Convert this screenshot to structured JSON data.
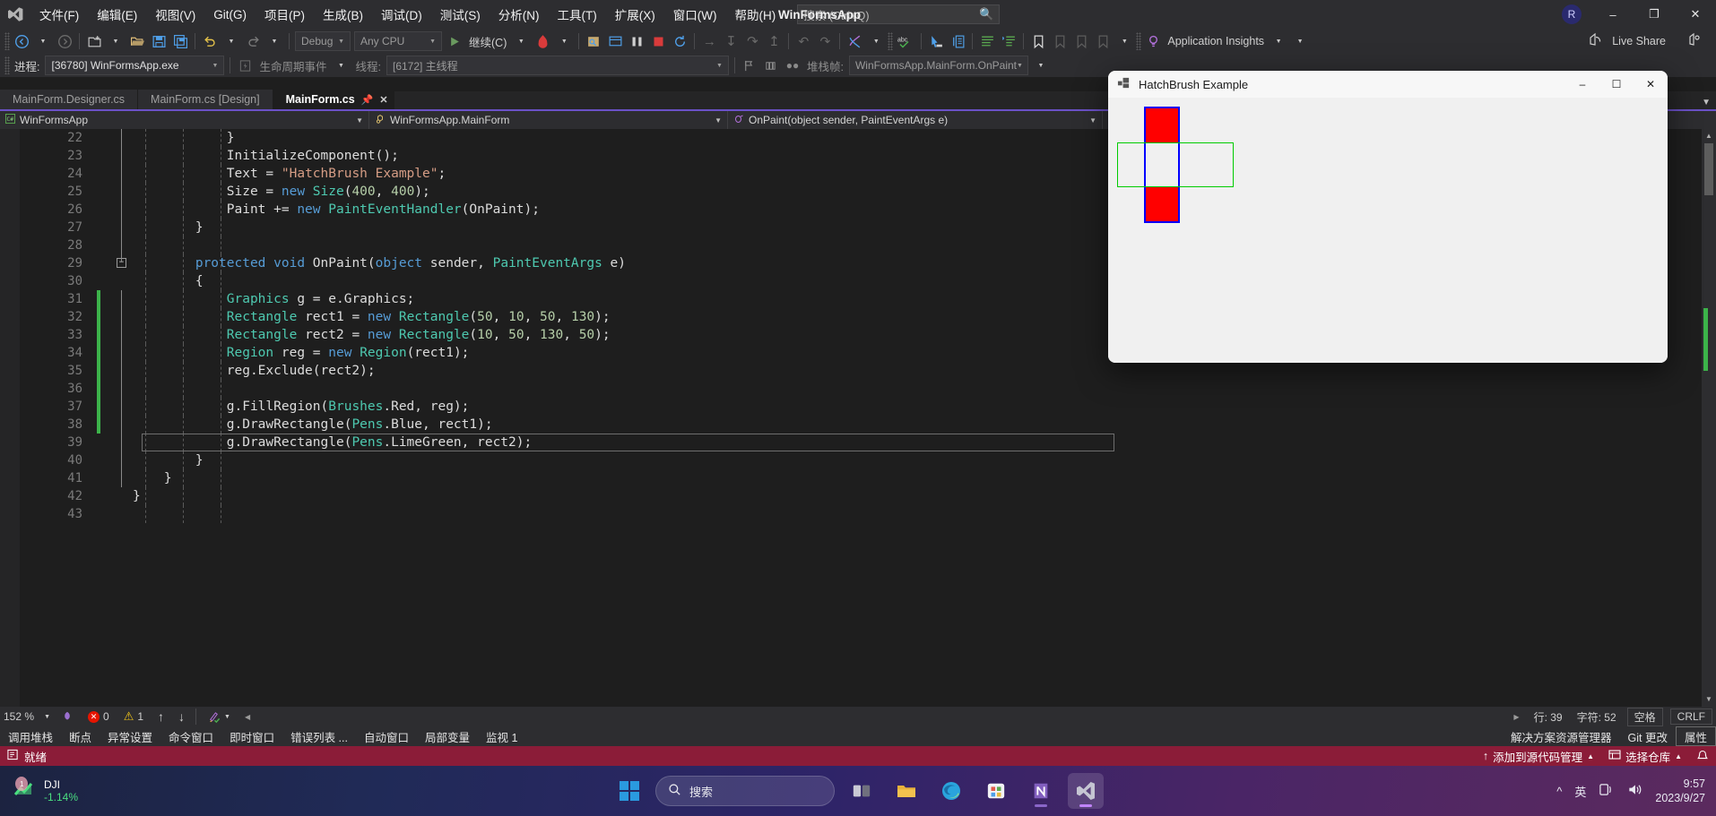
{
  "window": {
    "app_title": "WinFormsApp",
    "account_initial": "R",
    "minimize": "–",
    "restore": "❐",
    "close": "✕"
  },
  "menu": {
    "items": [
      {
        "label": "文件(F)",
        "name": "menu-file"
      },
      {
        "label": "编辑(E)",
        "name": "menu-edit"
      },
      {
        "label": "视图(V)",
        "name": "menu-view"
      },
      {
        "label": "Git(G)",
        "name": "menu-git"
      },
      {
        "label": "项目(P)",
        "name": "menu-project"
      },
      {
        "label": "生成(B)",
        "name": "menu-build"
      },
      {
        "label": "调试(D)",
        "name": "menu-debug"
      },
      {
        "label": "测试(S)",
        "name": "menu-test"
      },
      {
        "label": "分析(N)",
        "name": "menu-analyze"
      },
      {
        "label": "工具(T)",
        "name": "menu-tools"
      },
      {
        "label": "扩展(X)",
        "name": "menu-extensions"
      },
      {
        "label": "窗口(W)",
        "name": "menu-window"
      },
      {
        "label": "帮助(H)",
        "name": "menu-help"
      }
    ],
    "search_placeholder": "搜索 (Ctrl+Q)"
  },
  "toolbar": {
    "config": "Debug",
    "platform": "Any CPU",
    "continue_label": "继续(C)",
    "app_insights": "Application Insights",
    "live_share": "Live Share"
  },
  "debugbar": {
    "process_label": "进程:",
    "process_value": "[36780] WinFormsApp.exe",
    "lifecycle_label": "生命周期事件",
    "thread_label": "线程:",
    "thread_value": "[6172] 主线程",
    "stackframe_label": "堆栈帧:",
    "stackframe_value": "WinFormsApp.MainForm.OnPaint"
  },
  "tabs": [
    {
      "label": "MainForm.Designer.cs",
      "active": false
    },
    {
      "label": "MainForm.cs [Design]",
      "active": false
    },
    {
      "label": "MainForm.cs",
      "active": true
    }
  ],
  "navbar": {
    "project": "WinFormsApp",
    "type": "WinFormsApp.MainForm",
    "member": "OnPaint(object sender, PaintEventArgs e)"
  },
  "code": {
    "lines": [
      {
        "num": "22",
        "changed": false,
        "tokens": [
          {
            "t": "            }",
            "c": "k-def"
          }
        ]
      },
      {
        "num": "23",
        "changed": false,
        "tokens": [
          {
            "t": "            ",
            "c": "k-def"
          },
          {
            "t": "InitializeComponent",
            "c": "k-def"
          },
          {
            "t": "();",
            "c": "k-def"
          }
        ]
      },
      {
        "num": "24",
        "changed": false,
        "tokens": [
          {
            "t": "            Text = ",
            "c": "k-def"
          },
          {
            "t": "\"HatchBrush Example\"",
            "c": "k-str"
          },
          {
            "t": ";",
            "c": "k-def"
          }
        ]
      },
      {
        "num": "25",
        "changed": false,
        "tokens": [
          {
            "t": "            Size = ",
            "c": "k-def"
          },
          {
            "t": "new ",
            "c": "k-blue"
          },
          {
            "t": "Size",
            "c": "k-cyan"
          },
          {
            "t": "(",
            "c": "k-def"
          },
          {
            "t": "400",
            "c": "k-num"
          },
          {
            "t": ", ",
            "c": "k-def"
          },
          {
            "t": "400",
            "c": "k-num"
          },
          {
            "t": ");",
            "c": "k-def"
          }
        ]
      },
      {
        "num": "26",
        "changed": false,
        "tokens": [
          {
            "t": "            Paint += ",
            "c": "k-def"
          },
          {
            "t": "new ",
            "c": "k-blue"
          },
          {
            "t": "PaintEventHandler",
            "c": "k-cyan"
          },
          {
            "t": "(OnPaint);",
            "c": "k-def"
          }
        ]
      },
      {
        "num": "27",
        "changed": false,
        "tokens": [
          {
            "t": "        }",
            "c": "k-def"
          }
        ]
      },
      {
        "num": "28",
        "changed": false,
        "tokens": []
      },
      {
        "num": "29",
        "changed": false,
        "tokens": [
          {
            "t": "        ",
            "c": "k-def"
          },
          {
            "t": "protected void ",
            "c": "k-blue"
          },
          {
            "t": "OnPaint",
            "c": "k-def"
          },
          {
            "t": "(",
            "c": "k-def"
          },
          {
            "t": "object",
            "c": "k-blue"
          },
          {
            "t": " sender, ",
            "c": "k-def"
          },
          {
            "t": "PaintEventArgs",
            "c": "k-cyan"
          },
          {
            "t": " e)",
            "c": "k-def"
          }
        ]
      },
      {
        "num": "30",
        "changed": false,
        "tokens": [
          {
            "t": "        {",
            "c": "k-def"
          }
        ]
      },
      {
        "num": "31",
        "changed": true,
        "tokens": [
          {
            "t": "            ",
            "c": "k-def"
          },
          {
            "t": "Graphics",
            "c": "k-cyan"
          },
          {
            "t": " g = e.Graphics;",
            "c": "k-def"
          }
        ]
      },
      {
        "num": "32",
        "changed": true,
        "tokens": [
          {
            "t": "            ",
            "c": "k-def"
          },
          {
            "t": "Rectangle",
            "c": "k-cyan"
          },
          {
            "t": " rect1 = ",
            "c": "k-def"
          },
          {
            "t": "new ",
            "c": "k-blue"
          },
          {
            "t": "Rectangle",
            "c": "k-cyan"
          },
          {
            "t": "(",
            "c": "k-def"
          },
          {
            "t": "50",
            "c": "k-num"
          },
          {
            "t": ", ",
            "c": "k-def"
          },
          {
            "t": "10",
            "c": "k-num"
          },
          {
            "t": ", ",
            "c": "k-def"
          },
          {
            "t": "50",
            "c": "k-num"
          },
          {
            "t": ", ",
            "c": "k-def"
          },
          {
            "t": "130",
            "c": "k-num"
          },
          {
            "t": ");",
            "c": "k-def"
          }
        ]
      },
      {
        "num": "33",
        "changed": true,
        "tokens": [
          {
            "t": "            ",
            "c": "k-def"
          },
          {
            "t": "Rectangle",
            "c": "k-cyan"
          },
          {
            "t": " rect2 = ",
            "c": "k-def"
          },
          {
            "t": "new ",
            "c": "k-blue"
          },
          {
            "t": "Rectangle",
            "c": "k-cyan"
          },
          {
            "t": "(",
            "c": "k-def"
          },
          {
            "t": "10",
            "c": "k-num"
          },
          {
            "t": ", ",
            "c": "k-def"
          },
          {
            "t": "50",
            "c": "k-num"
          },
          {
            "t": ", ",
            "c": "k-def"
          },
          {
            "t": "130",
            "c": "k-num"
          },
          {
            "t": ", ",
            "c": "k-def"
          },
          {
            "t": "50",
            "c": "k-num"
          },
          {
            "t": ");",
            "c": "k-def"
          }
        ]
      },
      {
        "num": "34",
        "changed": true,
        "tokens": [
          {
            "t": "            ",
            "c": "k-def"
          },
          {
            "t": "Region",
            "c": "k-cyan"
          },
          {
            "t": " reg = ",
            "c": "k-def"
          },
          {
            "t": "new ",
            "c": "k-blue"
          },
          {
            "t": "Region",
            "c": "k-cyan"
          },
          {
            "t": "(rect1);",
            "c": "k-def"
          }
        ]
      },
      {
        "num": "35",
        "changed": true,
        "tokens": [
          {
            "t": "            reg.Exclude(rect2);",
            "c": "k-def"
          }
        ]
      },
      {
        "num": "36",
        "changed": true,
        "tokens": []
      },
      {
        "num": "37",
        "changed": true,
        "tokens": [
          {
            "t": "            g.FillRegion(",
            "c": "k-def"
          },
          {
            "t": "Brushes",
            "c": "k-cyan"
          },
          {
            "t": ".Red, reg);",
            "c": "k-def"
          }
        ]
      },
      {
        "num": "38",
        "changed": true,
        "tokens": [
          {
            "t": "            g.DrawRectangle(",
            "c": "k-def"
          },
          {
            "t": "Pens",
            "c": "k-cyan"
          },
          {
            "t": ".Blue, rect1);",
            "c": "k-def"
          }
        ]
      },
      {
        "num": "39",
        "changed": false,
        "current": true,
        "tokens": [
          {
            "t": "            g.DrawRectangle(",
            "c": "k-def"
          },
          {
            "t": "Pens",
            "c": "k-cyan"
          },
          {
            "t": ".LimeGreen, rect2);",
            "c": "k-def"
          }
        ]
      },
      {
        "num": "40",
        "changed": false,
        "tokens": [
          {
            "t": "        }",
            "c": "k-def"
          }
        ]
      },
      {
        "num": "41",
        "changed": false,
        "tokens": [
          {
            "t": "    }",
            "c": "k-def"
          }
        ]
      },
      {
        "num": "42",
        "changed": false,
        "tokens": [
          {
            "t": "}",
            "c": "k-def"
          }
        ]
      },
      {
        "num": "43",
        "changed": false,
        "tokens": []
      }
    ]
  },
  "editor_status": {
    "zoom": "152 %",
    "error_count": "0",
    "warning_count": "1",
    "line_label": "行: 39",
    "char_label": "字符: 52",
    "indent": "空格",
    "eol": "CRLF"
  },
  "dock": {
    "tabs": [
      "调用堆栈",
      "断点",
      "异常设置",
      "命令窗口",
      "即时窗口",
      "错误列表 ...",
      "自动窗口",
      "局部变量",
      "监视 1"
    ],
    "right_tabs": [
      {
        "label": "解决方案资源管理器",
        "selected": false
      },
      {
        "label": "Git 更改",
        "selected": false
      },
      {
        "label": "属性",
        "selected": true
      }
    ]
  },
  "statusbar": {
    "ready": "就绪",
    "source_control": "添加到源代码管理",
    "repo": "选择仓库"
  },
  "app_window": {
    "title": "HatchBrush Example",
    "minimize": "–",
    "maximize": "☐",
    "close": "✕",
    "shapes": {
      "fill_color": "#ff0000",
      "rect1_pen": "#0000ff",
      "rect2_pen": "#00cc00"
    }
  },
  "taskbar": {
    "widget_name": "DJI",
    "widget_pct": "-1.14%",
    "search_placeholder": "搜索",
    "ime": "英",
    "time": "9:57",
    "date": "2023/9/27"
  }
}
